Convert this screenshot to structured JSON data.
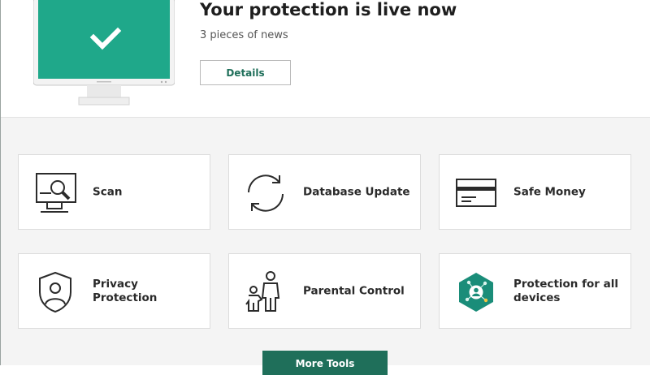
{
  "status": {
    "title": "Your protection is live now",
    "news_count": "3 pieces of news",
    "details_label": "Details"
  },
  "tiles": [
    {
      "label": "Scan",
      "icon": "monitor-magnifier-icon"
    },
    {
      "label": "Database Update",
      "icon": "refresh-arrows-icon"
    },
    {
      "label": "Safe Money",
      "icon": "credit-card-icon"
    },
    {
      "label": "Privacy Protection",
      "icon": "shield-user-icon"
    },
    {
      "label": "Parental Control",
      "icon": "parent-child-icon"
    },
    {
      "label": "Protection for all devices",
      "icon": "hexagon-network-icon"
    }
  ],
  "footer": {
    "more_tools_label": "More Tools"
  },
  "colors": {
    "accent": "#1f6f5a",
    "status_green": "#1fa88a",
    "panel_background": "#f4f4f4"
  }
}
